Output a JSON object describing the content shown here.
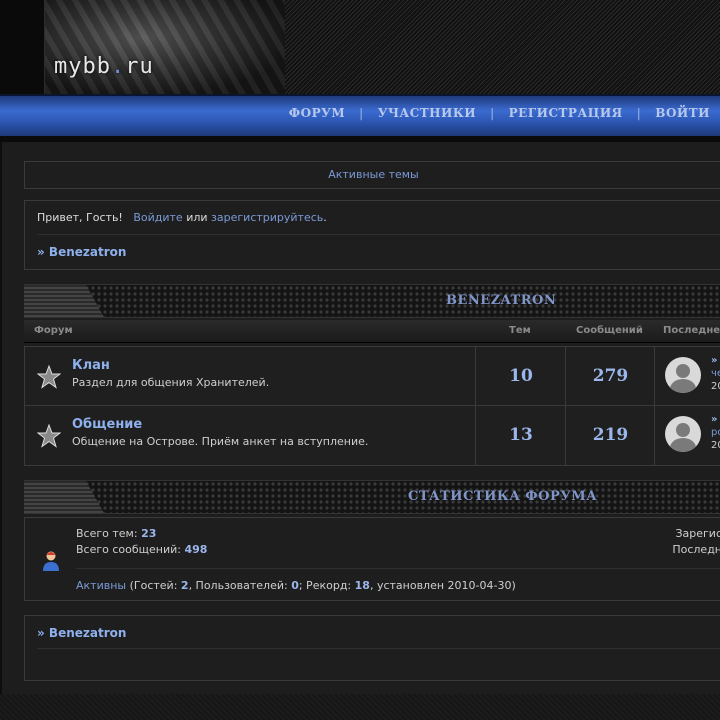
{
  "header": {
    "logo_main": "mybb",
    "logo_dot": ".",
    "logo_tld": "ru"
  },
  "nav": {
    "items": [
      "ФОРУМ",
      "УЧАСТНИКИ",
      "РЕГИСТРАЦИЯ",
      "ВОЙТИ"
    ],
    "separator": "|"
  },
  "active_topics": "Активные темы",
  "greeting": {
    "hello": "Привет, Гость!",
    "login": "Войдите",
    "or": "или",
    "register": "зарегистрируйтесь",
    "end": "."
  },
  "breadcrumb": "» Benezatron",
  "category": {
    "title": "BENEZATRON"
  },
  "columns": {
    "forum": "Форум",
    "topics": "Тем",
    "posts": "Сообщений",
    "last": "Последнее"
  },
  "forums": [
    {
      "name": "Клан",
      "desc": "Раздел для общения Хранителей.",
      "topics": "10",
      "posts": "279",
      "last_l1": "»",
      "last_l2": "че",
      "last_l3": "20"
    },
    {
      "name": "Общение",
      "desc": "Общение на Острове. Приём анкет на вступление.",
      "topics": "13",
      "posts": "219",
      "last_l1": "»",
      "last_l2": "ро",
      "last_l3": "20"
    }
  ],
  "stats": {
    "title": "СТАТИСТИКА ФОРУМА",
    "topics_label": "Всего тем:",
    "topics_value": "23",
    "posts_label": "Всего сообщений:",
    "posts_value": "498",
    "right1": "Зарегис",
    "right2": "Последн",
    "active_link": "Активны",
    "guests_label": " (Гостей: ",
    "guests": "2",
    "users_label": ", Пользователей: ",
    "users": "0",
    "record_label": "; Рекорд: ",
    "record": "18",
    "record_date": ", установлен 2010-04-30)"
  },
  "bottom_breadcrumb": "» Benezatron",
  "colors": {
    "accent": "#8eb0ec",
    "nav_blue": "#3b6bd0",
    "link": "#7b9ad6"
  }
}
